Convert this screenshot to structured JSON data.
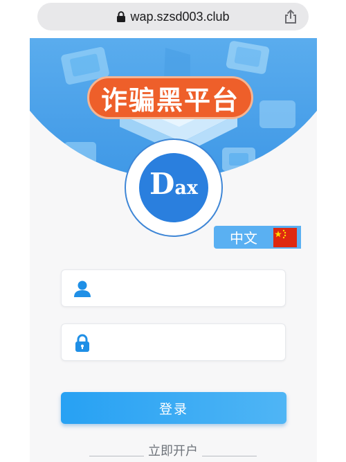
{
  "browser": {
    "url": "wap.szsd003.club",
    "lock_icon": "lock-icon",
    "share_icon": "share-icon"
  },
  "hero": {
    "banner_text": "诈骗黑平台",
    "banner_color": "#ee5f2a",
    "background_color": "#5fb0ef"
  },
  "logo": {
    "letter_big": "D",
    "letter_small": "ax",
    "color": "#2a7fde"
  },
  "language": {
    "label": "中文",
    "flag_icon": "china-flag-icon"
  },
  "form": {
    "username": {
      "value": "",
      "icon": "user-icon"
    },
    "password": {
      "value": "",
      "icon": "lock-icon"
    },
    "login_label": "登录",
    "register_label": "立即开户",
    "accent_color": "#27a1f3"
  }
}
